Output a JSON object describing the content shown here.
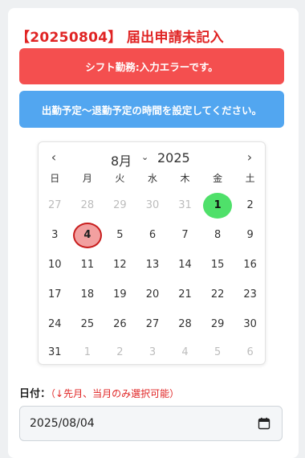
{
  "title": "【20250804】 届出申請未記入",
  "alerts": {
    "error": "シフト勤務:入力エラーです。",
    "info": "出勤予定〜退勤予定の時間を設定してください。"
  },
  "calendar": {
    "prev_icon": "chevron-left-icon",
    "next_icon": "chevron-right-icon",
    "month": "8月",
    "year": "2025",
    "weekdays": [
      "日",
      "月",
      "火",
      "水",
      "木",
      "金",
      "土"
    ],
    "weeks": [
      [
        "27",
        "28",
        "29",
        "30",
        "31",
        "1",
        "2"
      ],
      [
        "3",
        "4",
        "5",
        "6",
        "7",
        "8",
        "9"
      ],
      [
        "10",
        "11",
        "12",
        "13",
        "14",
        "15",
        "16"
      ],
      [
        "17",
        "18",
        "19",
        "20",
        "21",
        "22",
        "23"
      ],
      [
        "24",
        "25",
        "26",
        "27",
        "28",
        "29",
        "30"
      ],
      [
        "31",
        "1",
        "2",
        "3",
        "4",
        "5",
        "6"
      ]
    ],
    "today": "1",
    "selected": "4",
    "colors": {
      "today": "#4fe06a",
      "selected_fill": "#f2a0a0",
      "selected_border": "#c81e1e"
    }
  },
  "date_field": {
    "label": "日付：",
    "hint": "（↓先月、当月のみ選択可能）",
    "value": "2025/08/04",
    "icon": "calendar-icon"
  },
  "colors": {
    "title": "#e02424",
    "alert_error": "#f44f4f",
    "alert_info": "#52a6f0"
  }
}
